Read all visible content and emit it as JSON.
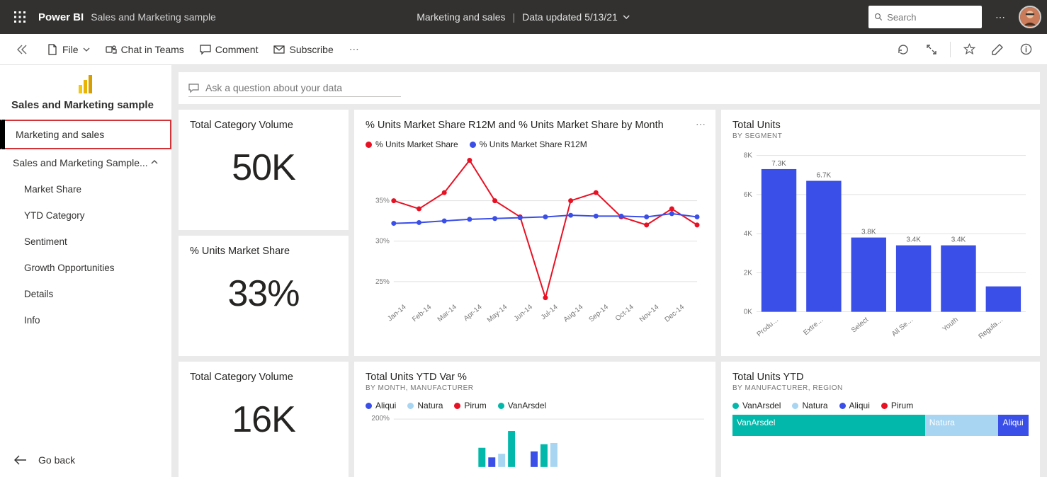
{
  "header": {
    "brand": "Power BI",
    "workspace": "Sales and Marketing sample",
    "center_title": "Marketing and sales",
    "center_meta": "Data updated 5/13/21",
    "search_placeholder": "Search"
  },
  "toolbar": {
    "file": "File",
    "chat": "Chat in Teams",
    "comment": "Comment",
    "subscribe": "Subscribe"
  },
  "sidebar": {
    "title": "Sales and Marketing sample",
    "selected": "Marketing and sales",
    "dataset": "Sales and Marketing Sample...",
    "pages": [
      "Market Share",
      "YTD Category",
      "Sentiment",
      "Growth Opportunities",
      "Details",
      "Info"
    ],
    "go_back": "Go back"
  },
  "qna": {
    "placeholder": "Ask a question about your data"
  },
  "tiles": {
    "tcv1": {
      "title": "Total Category Volume",
      "value": "50K"
    },
    "ums": {
      "title": "% Units Market Share",
      "value": "33%"
    },
    "tcv2": {
      "title": "Total Category Volume",
      "value": "16K"
    },
    "line": {
      "title": "% Units Market Share R12M and % Units Market Share by Month",
      "legend": [
        "% Units Market Share",
        "% Units Market Share R12M"
      ]
    },
    "bar": {
      "title": "Total Units",
      "sub": "BY SEGMENT"
    },
    "ytdvar": {
      "title": "Total Units YTD Var %",
      "sub": "BY MONTH, MANUFACTURER",
      "legend": [
        "Aliqui",
        "Natura",
        "Pirum",
        "VanArsdel"
      ]
    },
    "ytd": {
      "title": "Total Units YTD",
      "sub": "BY MANUFACTURER, REGION",
      "legend": [
        "VanArsdel",
        "Natura",
        "Aliqui",
        "Pirum"
      ],
      "tree": [
        "VanArsdel",
        "Natura",
        "Aliqui"
      ]
    }
  },
  "colors": {
    "red": "#e81123",
    "blue": "#3a4ee8",
    "teal": "#01b8aa",
    "ltblue": "#8eccf0",
    "natura": "#a7d5f2"
  },
  "chart_data": [
    {
      "id": "line",
      "type": "line",
      "title": "% Units Market Share R12M and % Units Market Share by Month",
      "xlabel": "",
      "ylabel": "",
      "ylim": [
        23,
        40
      ],
      "yticks": [
        25,
        30,
        35
      ],
      "categories": [
        "Jan-14",
        "Feb-14",
        "Mar-14",
        "Apr-14",
        "May-14",
        "Jun-14",
        "Jul-14",
        "Aug-14",
        "Sep-14",
        "Oct-14",
        "Nov-14",
        "Dec-14"
      ],
      "series": [
        {
          "name": "% Units Market Share",
          "color": "#e81123",
          "values": [
            35,
            34,
            36,
            40,
            35,
            33,
            23,
            35,
            36,
            33,
            32,
            34,
            32
          ]
        },
        {
          "name": "% Units Market Share R12M",
          "color": "#3a4ee8",
          "values": [
            32.2,
            32.3,
            32.5,
            32.7,
            32.8,
            32.9,
            33.0,
            33.2,
            33.1,
            33.1,
            33.0,
            33.4,
            33.0
          ]
        }
      ]
    },
    {
      "id": "bar",
      "type": "bar",
      "title": "Total Units by Segment",
      "xlabel": "",
      "ylabel": "",
      "ylim": [
        0,
        8
      ],
      "yticks": [
        0,
        2,
        4,
        6,
        8
      ],
      "ytick_labels": [
        "0K",
        "2K",
        "4K",
        "6K",
        "8K"
      ],
      "categories": [
        "Produ…",
        "Extre…",
        "Select",
        "All Se…",
        "Youth",
        "Regula…"
      ],
      "labels_top": [
        "7.3K",
        "6.7K",
        "3.8K",
        "3.4K",
        "3.4K",
        ""
      ],
      "values": [
        7.3,
        6.7,
        3.8,
        3.4,
        3.4,
        1.3
      ],
      "color": "#3a4ee8"
    },
    {
      "id": "ytdvar",
      "type": "bar",
      "title": "Total Units YTD Var % by Month, Manufacturer",
      "yticks": [
        200
      ],
      "ytick_labels": [
        "200%"
      ],
      "categories": [],
      "series": [
        {
          "name": "Aliqui",
          "color": "#3a4ee8"
        },
        {
          "name": "Natura",
          "color": "#a7d5f2"
        },
        {
          "name": "Pirum",
          "color": "#e81123"
        },
        {
          "name": "VanArsdel",
          "color": "#01b8aa"
        }
      ],
      "visible_bars": [
        {
          "series": "VanArsdel",
          "h": 80
        },
        {
          "series": "Aliqui",
          "h": 40
        },
        {
          "series": "Natura",
          "h": 55
        },
        {
          "series": "VanArsdel",
          "h": 150
        },
        {
          "series": "Aliqui",
          "h": 65
        },
        {
          "series": "VanArsdel",
          "h": 95
        },
        {
          "series": "Natura",
          "h": 100
        }
      ]
    },
    {
      "id": "ytd_tree",
      "type": "area",
      "title": "Total Units YTD by Manufacturer, Region",
      "series": [
        {
          "name": "VanArsdel",
          "share": 0.68,
          "color": "#01b8aa"
        },
        {
          "name": "Natura",
          "share": 0.24,
          "color": "#a7d5f2"
        },
        {
          "name": "Aliqui",
          "share": 0.08,
          "color": "#3a4ee8"
        }
      ]
    }
  ]
}
